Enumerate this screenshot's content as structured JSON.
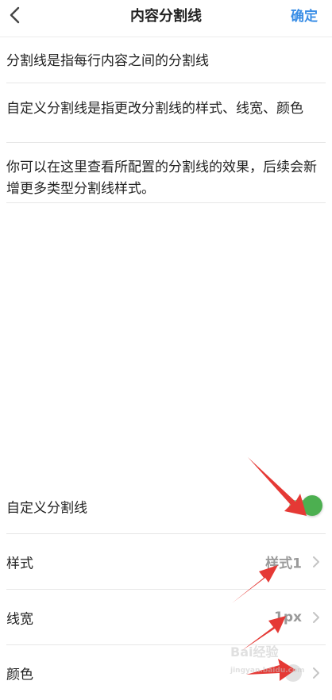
{
  "nav": {
    "back_icon": "chevron-left-icon",
    "title": "内容分割线",
    "confirm_label": "确定"
  },
  "descriptions": [
    "分割线是指每行内容之间的分割线",
    "自定义分割线是指更改分割线的样式、线宽、颜色",
    "你可以在这里查看所配置的分割线的效果，后续会新增更多类型分割线样式。"
  ],
  "settings": {
    "custom_divider": {
      "label": "自定义分割线",
      "enabled": true
    },
    "style": {
      "label": "样式",
      "value": "样式1"
    },
    "width": {
      "label": "线宽",
      "value": "1px"
    },
    "color": {
      "label": "颜色"
    }
  },
  "colors": {
    "accent": "#3a8ee6",
    "toggle_on": "#4caf50",
    "annotation_arrow": "#e53935"
  },
  "watermark": {
    "text": "Bai经验",
    "subtext": "jingyan.baidu.com"
  }
}
